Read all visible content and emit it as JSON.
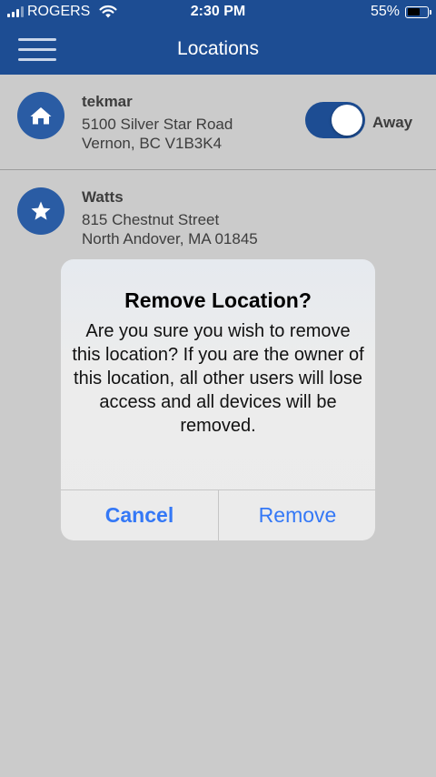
{
  "status_bar": {
    "carrier": "ROGERS",
    "time": "2:30 PM",
    "battery_percent": "55%",
    "battery_level": 0.55,
    "icons": [
      "signal-icon",
      "wifi-icon",
      "battery-icon"
    ]
  },
  "nav": {
    "title": "Locations",
    "menu_icon": "hamburger-menu-icon"
  },
  "locations": [
    {
      "name": "tekmar",
      "address_line1": "5100 Silver Star Road",
      "address_line2": "Vernon, BC V1B3K4",
      "icon": "home-icon",
      "mode_label": "Away",
      "mode_on": true
    },
    {
      "name": "Watts",
      "address_line1": "815 Chestnut Street",
      "address_line2": "North Andover, MA 01845",
      "icon": "star-icon"
    }
  ],
  "alert": {
    "title": "Remove Location?",
    "message": "Are you sure you wish to remove this location? If you are the owner of this location, all other users will lose access and all devices will be removed.",
    "cancel_label": "Cancel",
    "remove_label": "Remove"
  },
  "colors": {
    "nav_background": "#1d4d93",
    "icon_circle": "#2a5ca4",
    "dimmed_background": "#cbcbcb",
    "alert_button_text": "#3478f6"
  }
}
